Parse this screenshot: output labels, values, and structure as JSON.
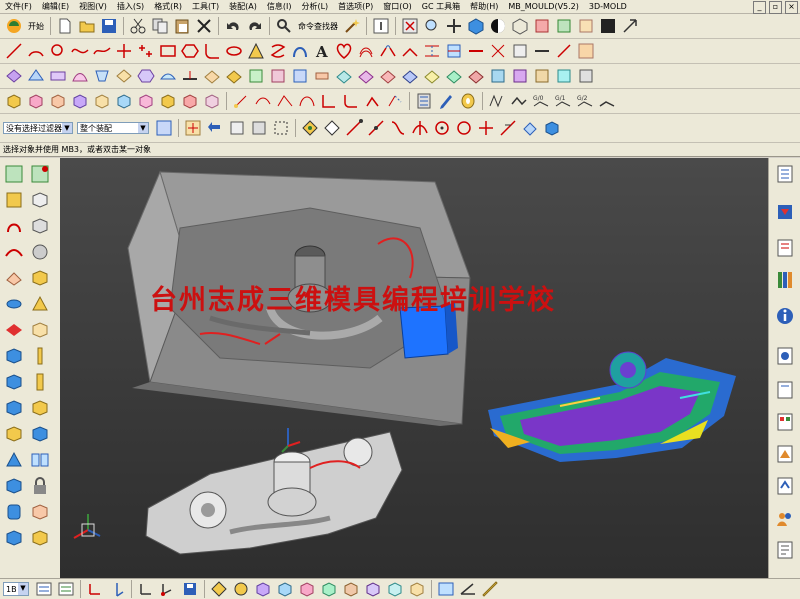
{
  "menubar": {
    "items": [
      "文件(F)",
      "编辑(E)",
      "视图(V)",
      "插入(S)",
      "格式(R)",
      "工具(T)",
      "装配(A)",
      "信息(I)",
      "分析(L)",
      "首选项(P)",
      "窗口(O)",
      "GC 工具箱",
      "帮助(H)",
      "MB_MOULD(V5.2)",
      "3D-MOLD"
    ]
  },
  "standard_toolbar": {
    "start_label": "开始",
    "command_finder_label": "命令查找器"
  },
  "selection_bar": {
    "filter_value": "没有选择过滤器",
    "scope_value": "整个装配"
  },
  "cue_line": {
    "text": "选择对象并使用 MB3，或者双击某一对象"
  },
  "viewport": {
    "watermark": "台州志成三维模具编程培训学校",
    "background_top": "#4a4a4a",
    "background_bottom": "#2e2e2e"
  },
  "statusbar": {
    "layer_value": "1B"
  },
  "colors": {
    "accent_red": "#cc1010",
    "mold_gray": "#8e8e8e",
    "insert_blue": "#1e73ff"
  }
}
